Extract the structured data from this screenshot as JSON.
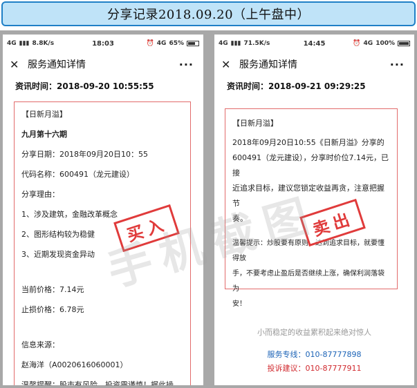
{
  "banner": {
    "title": "分享记录2018.09.20（上午盘中）"
  },
  "left": {
    "status": {
      "network": "4G",
      "speed": "8.8K/s",
      "time": "18:03",
      "signal": "4G",
      "battery": "65%",
      "battery_level": 0.65
    },
    "nav_title": "服务通知详情",
    "more": "···",
    "info_time": "资讯时间：2018-09-20 10:55:55",
    "card_lines": [
      "【日新月溢】",
      "九月第十六期",
      "分享日期：2018年09月20日10：55",
      "代码名称：600491（龙元建设）",
      "分享理由：",
      "1、涉及建筑，金融改革概念",
      "2、图形结构较为稳健",
      "3、近期发现资金异动",
      "当前价格：7.14元",
      "止损价格：6.78元",
      "信息来源：",
      "赵海洋（A0020616060001）",
      "温馨提醒：股市有风险，投资需谨慎！据此操"
    ],
    "stamp": "买入"
  },
  "right": {
    "status": {
      "network": "4G",
      "speed": "71.5K/s",
      "time": "14:45",
      "signal": "4G",
      "battery": "100%",
      "battery_level": 1.0
    },
    "nav_title": "服务通知详情",
    "more": "···",
    "info_time": "资讯时间：2018-09-21 09:29:25",
    "card_lines": [
      "【日新月溢】",
      "2018年09月20日10:55《日新月溢》分享的",
      "600491（龙元建设），分享时价位7.14元，已接",
      "近追求目标，建议您锁定收益再贪，注意把握节",
      "奏。",
      "温馨提示：炒股要有原则，达到追求目标，就要懂得放",
      "手，不要考虑止盈后是否继续上涨，确保利润落袋为",
      "安！"
    ],
    "stamp": "卖出",
    "slogan": "小而稳定的收益累积起来绝对惊人",
    "service": "服务专线：010-87777898",
    "complaint": "投诉建议：010-87777911"
  },
  "watermark": "手机截图"
}
